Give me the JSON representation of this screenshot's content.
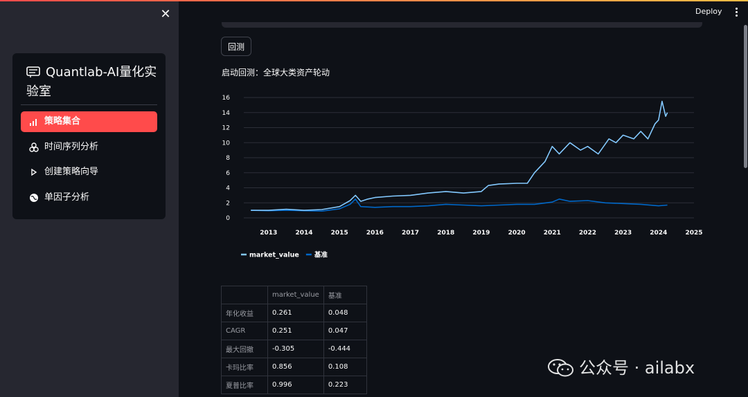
{
  "sidebar": {
    "title": "Quantlab-AI量化实验室",
    "items": [
      {
        "label": "策略集合",
        "icon": "bar-chart-icon",
        "active": true
      },
      {
        "label": "时间序列分析",
        "icon": "molecule-icon",
        "active": false
      },
      {
        "label": "创建策略向导",
        "icon": "play-icon",
        "active": false
      },
      {
        "label": "单因子分析",
        "icon": "globe-icon",
        "active": false
      }
    ]
  },
  "header": {
    "deploy_label": "Deploy"
  },
  "main": {
    "backtest_button": "回测",
    "start_text": "启动回测：全球大类资产轮动"
  },
  "colors": {
    "accent": "#ff4b4b",
    "series_market": "#83c9ff",
    "series_bench": "#0068c9"
  },
  "chart_data": {
    "type": "line",
    "x_ticks": [
      "2013",
      "2014",
      "2015",
      "2016",
      "2017",
      "2018",
      "2019",
      "2020",
      "2021",
      "2022",
      "2023",
      "2024",
      "2025"
    ],
    "y_ticks": [
      "0",
      "2",
      "4",
      "6",
      "8",
      "10",
      "12",
      "14",
      "16"
    ],
    "xlim": [
      2012.3,
      2025.0
    ],
    "ylim": [
      0,
      16
    ],
    "grid": true,
    "legend_position": "bottom-left",
    "series": [
      {
        "name": "market_value",
        "x": [
          2012.5,
          2013.0,
          2013.5,
          2014.0,
          2014.5,
          2015.0,
          2015.3,
          2015.45,
          2015.6,
          2015.8,
          2016.0,
          2016.5,
          2017.0,
          2017.5,
          2018.0,
          2018.5,
          2019.0,
          2019.2,
          2019.5,
          2020.0,
          2020.3,
          2020.5,
          2020.8,
          2021.0,
          2021.2,
          2021.5,
          2021.8,
          2022.0,
          2022.3,
          2022.6,
          2022.8,
          2023.0,
          2023.3,
          2023.5,
          2023.7,
          2023.9,
          2024.0,
          2024.1,
          2024.2,
          2024.25
        ],
        "values": [
          1.0,
          1.0,
          1.15,
          1.0,
          1.1,
          1.5,
          2.3,
          3.0,
          2.2,
          2.5,
          2.7,
          2.9,
          3.0,
          3.3,
          3.5,
          3.3,
          3.5,
          4.3,
          4.5,
          4.6,
          4.6,
          6.0,
          7.5,
          9.5,
          8.5,
          10.0,
          9.0,
          9.5,
          8.5,
          10.5,
          10.0,
          11.0,
          10.5,
          11.5,
          10.5,
          12.5,
          13.0,
          15.5,
          13.5,
          14.0
        ]
      },
      {
        "name": "基准",
        "x": [
          2012.5,
          2013.0,
          2013.5,
          2014.0,
          2014.5,
          2015.0,
          2015.3,
          2015.45,
          2015.6,
          2016.0,
          2016.5,
          2017.0,
          2017.5,
          2018.0,
          2018.5,
          2019.0,
          2019.5,
          2020.0,
          2020.5,
          2021.0,
          2021.2,
          2021.5,
          2022.0,
          2022.5,
          2023.0,
          2023.5,
          2024.0,
          2024.25
        ],
        "values": [
          1.0,
          0.95,
          1.0,
          0.95,
          0.9,
          1.2,
          1.8,
          2.5,
          1.5,
          1.4,
          1.5,
          1.5,
          1.6,
          1.8,
          1.7,
          1.6,
          1.7,
          1.8,
          1.8,
          2.1,
          2.5,
          2.2,
          2.3,
          2.0,
          1.9,
          1.8,
          1.6,
          1.7
        ]
      }
    ]
  },
  "table": {
    "headers": [
      "",
      "market_value",
      "基准"
    ],
    "rows": [
      [
        "年化收益",
        "0.261",
        "0.048"
      ],
      [
        "CAGR",
        "0.251",
        "0.047"
      ],
      [
        "最大回撤",
        "-0.305",
        "-0.444"
      ],
      [
        "卡玛比率",
        "0.856",
        "0.108"
      ],
      [
        "夏普比率",
        "0.996",
        "0.223"
      ]
    ]
  },
  "watermark": "公众号 · ailabx"
}
